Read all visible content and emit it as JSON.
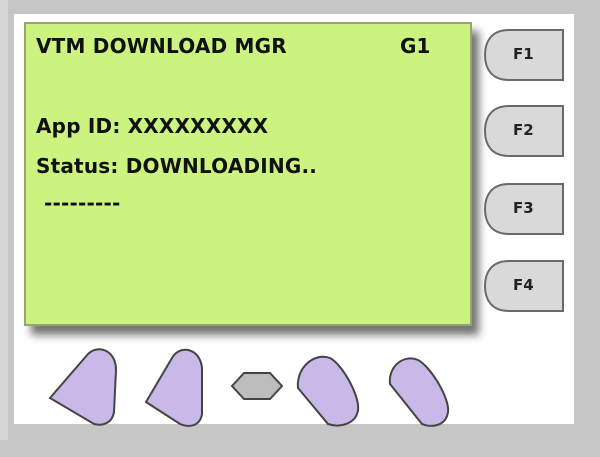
{
  "screen": {
    "title": "VTM DOWNLOAD MGR",
    "group": "G1",
    "app_id": "App ID: XXXXXXXXX",
    "status": "Status: DOWNLOADING..",
    "progress": "---------"
  },
  "function_keys": [
    "F1",
    "F2",
    "F3",
    "F4"
  ],
  "colors": {
    "screen_background": "#ccf27f",
    "soft_key_fill": "#c9b8e8",
    "function_key_fill": "#d9d9d9"
  }
}
